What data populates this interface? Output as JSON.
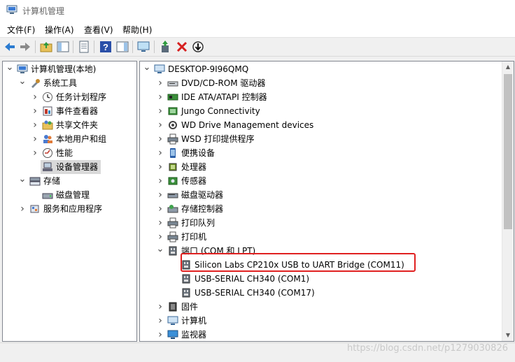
{
  "window": {
    "title": "计算机管理"
  },
  "menu": [
    {
      "label": "文件(F)"
    },
    {
      "label": "操作(A)"
    },
    {
      "label": "查看(V)"
    },
    {
      "label": "帮助(H)"
    }
  ],
  "left_tree": [
    {
      "label": "计算机管理(本地)",
      "icon": "computer-management-icon",
      "chev": "down",
      "level": 0
    },
    {
      "label": "系统工具",
      "icon": "tools-icon",
      "chev": "down",
      "level": 1
    },
    {
      "label": "任务计划程序",
      "icon": "clock-icon",
      "chev": "right",
      "level": 2
    },
    {
      "label": "事件查看器",
      "icon": "event-viewer-icon",
      "chev": "right",
      "level": 2
    },
    {
      "label": "共享文件夹",
      "icon": "shared-folder-icon",
      "chev": "right",
      "level": 2
    },
    {
      "label": "本地用户和组",
      "icon": "users-icon",
      "chev": "right",
      "level": 2
    },
    {
      "label": "性能",
      "icon": "performance-icon",
      "chev": "right",
      "level": 2
    },
    {
      "label": "设备管理器",
      "icon": "device-manager-icon",
      "chev": "",
      "level": 2,
      "selected": true
    },
    {
      "label": "存储",
      "icon": "storage-icon",
      "chev": "down",
      "level": 1
    },
    {
      "label": "磁盘管理",
      "icon": "disk-management-icon",
      "chev": "",
      "level": 2
    },
    {
      "label": "服务和应用程序",
      "icon": "services-icon",
      "chev": "right",
      "level": 1
    }
  ],
  "device_tree": [
    {
      "label": "DESKTOP-9I96QMQ",
      "icon": "computer-icon",
      "chev": "down",
      "level": 0
    },
    {
      "label": "DVD/CD-ROM 驱动器",
      "icon": "dvd-drive-icon",
      "chev": "right",
      "level": 1
    },
    {
      "label": "IDE ATA/ATAPI 控制器",
      "icon": "ide-controller-icon",
      "chev": "right",
      "level": 1
    },
    {
      "label": "Jungo Connectivity",
      "icon": "jungo-icon",
      "chev": "right",
      "level": 1
    },
    {
      "label": "WD Drive Management devices",
      "icon": "wd-gear-icon",
      "chev": "right",
      "level": 1
    },
    {
      "label": "WSD 打印提供程序",
      "icon": "printer-icon",
      "chev": "right",
      "level": 1
    },
    {
      "label": "便携设备",
      "icon": "portable-device-icon",
      "chev": "right",
      "level": 1
    },
    {
      "label": "处理器",
      "icon": "processor-icon",
      "chev": "right",
      "level": 1
    },
    {
      "label": "传感器",
      "icon": "sensor-icon",
      "chev": "right",
      "level": 1
    },
    {
      "label": "磁盘驱动器",
      "icon": "disk-drive-icon",
      "chev": "right",
      "level": 1
    },
    {
      "label": "存储控制器",
      "icon": "storage-controller-icon",
      "chev": "right",
      "level": 1
    },
    {
      "label": "打印队列",
      "icon": "print-queue-icon",
      "chev": "right",
      "level": 1
    },
    {
      "label": "打印机",
      "icon": "printer-icon",
      "chev": "right",
      "level": 1
    },
    {
      "label": "端口 (COM 和 LPT)",
      "icon": "port-icon",
      "chev": "down",
      "level": 1
    },
    {
      "label": "Silicon Labs CP210x USB to UART Bridge (COM11)",
      "icon": "port-icon",
      "chev": "",
      "level": 2
    },
    {
      "label": "USB-SERIAL CH340 (COM1)",
      "icon": "port-icon",
      "chev": "",
      "level": 2
    },
    {
      "label": "USB-SERIAL CH340 (COM17)",
      "icon": "port-icon",
      "chev": "",
      "level": 2
    },
    {
      "label": "固件",
      "icon": "firmware-icon",
      "chev": "right",
      "level": 1
    },
    {
      "label": "计算机",
      "icon": "computer-icon",
      "chev": "right",
      "level": 1
    },
    {
      "label": "监视器",
      "icon": "monitor-icon",
      "chev": "right",
      "level": 1
    }
  ],
  "watermark": "https://blog.csdn.net/p1279030826"
}
